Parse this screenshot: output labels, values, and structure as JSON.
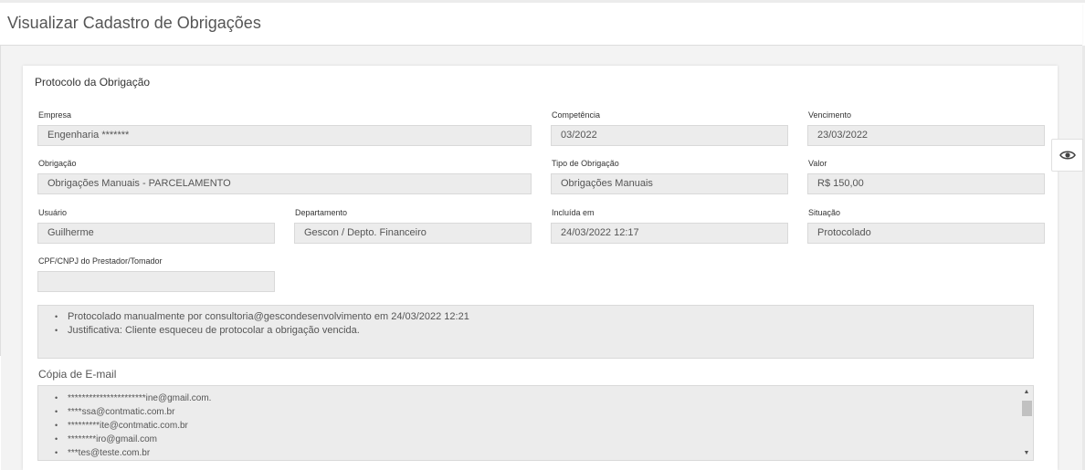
{
  "page": {
    "title": "Visualizar Cadastro de Obrigações"
  },
  "card": {
    "title": "Protocolo da Obrigação",
    "fields": {
      "empresa": {
        "label": "Empresa",
        "value": "Engenharia *******"
      },
      "competencia": {
        "label": "Competência",
        "value": "03/2022"
      },
      "vencimento": {
        "label": "Vencimento",
        "value": "23/03/2022"
      },
      "obrigacao": {
        "label": "Obrigação",
        "value": "Obrigações Manuais - PARCELAMENTO"
      },
      "tipo_obrigacao": {
        "label": "Tipo de Obrigação",
        "value": "Obrigações Manuais"
      },
      "valor": {
        "label": "Valor",
        "value": "R$ 150,00"
      },
      "usuario": {
        "label": "Usuário",
        "value": "Guilherme"
      },
      "departamento": {
        "label": "Departamento",
        "value": "Gescon / Depto. Financeiro"
      },
      "incluida_em": {
        "label": "Incluída em",
        "value": "24/03/2022 12:17"
      },
      "situacao": {
        "label": "Situação",
        "value": "Protocolado"
      },
      "cpf_cnpj": {
        "label": "CPF/CNPJ do Prestador/Tomador",
        "value": ""
      }
    },
    "notes": [
      "Protocolado manualmente por consultoria@gescondesenvolvimento em 24/03/2022 12:21",
      "Justificativa: Cliente esqueceu de protocolar a obrigação vencida."
    ],
    "email_copy": {
      "title": "Cópia de E-mail",
      "items": [
        "**********************ine@gmail.com.",
        "****ssa@contmatic.com.br",
        "*********ite@contmatic.com.br",
        "********iro@gmail.com",
        "***tes@teste.com.br"
      ]
    }
  },
  "side": {
    "view_icon": "eye-icon"
  },
  "colors": {
    "field_bg": "#ececec",
    "page_bg": "#f3f3f3",
    "text": "#555555"
  }
}
